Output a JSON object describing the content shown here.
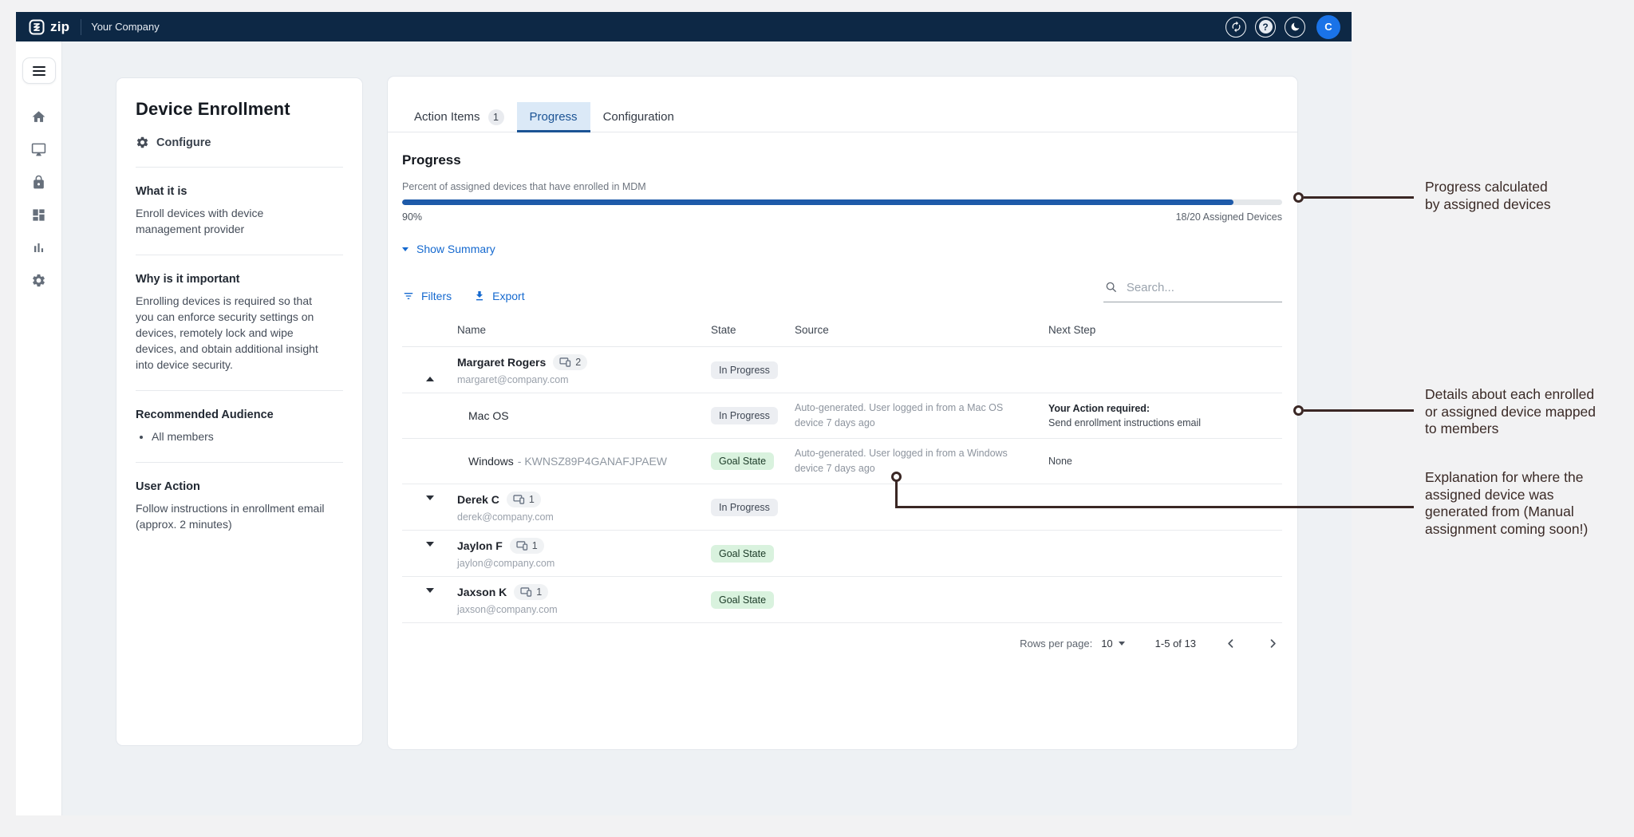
{
  "navbar": {
    "logo_text": "zip",
    "company_name": "Your Company",
    "avatar_initial": "C",
    "icons": [
      "sync-icon",
      "help-icon",
      "dark-mode-moon-icon"
    ],
    "colors": {
      "background": "#0d2845",
      "avatar": "#1a73e8"
    }
  },
  "sidebar": {
    "items": [
      {
        "icon": "home-icon"
      },
      {
        "icon": "monitor-icon"
      },
      {
        "icon": "lock-icon"
      },
      {
        "icon": "dashboard-icon"
      },
      {
        "icon": "bar-chart-icon"
      },
      {
        "icon": "gear-icon"
      }
    ]
  },
  "info_panel": {
    "title": "Device Enrollment",
    "configure_label": "Configure",
    "what_heading": "What it is",
    "what_body": "Enroll devices with device management provider",
    "why_heading": "Why is it important",
    "why_body": "Enrolling devices is required so that you can enforce security settings on devices, remotely lock and wipe devices, and obtain additional insight into device security.",
    "audience_heading": "Recommended Audience",
    "audience_items": [
      "All members"
    ],
    "action_heading": "User Action",
    "action_body": "Follow instructions in enrollment email (approx. 2 minutes)"
  },
  "main": {
    "tabs": [
      {
        "label": "Action Items",
        "badge": "1"
      },
      {
        "label": "Progress",
        "active": true
      },
      {
        "label": "Configuration"
      }
    ],
    "progress": {
      "heading": "Progress",
      "subtitle": "Percent of assigned devices that have enrolled in MDM",
      "percent_label": "90%",
      "fill_pct": 94.5,
      "assigned_label": "18/20 Assigned Devices",
      "fill_color": "#1e5aa9"
    },
    "summary_toggle_label": "Show Summary",
    "toolbar": {
      "filters_label": "Filters",
      "export_label": "Export",
      "search_placeholder": "Search..."
    },
    "table": {
      "columns": [
        "Name",
        "State",
        "Source",
        "Next Step"
      ],
      "rows": [
        {
          "kind": "member",
          "expanded": true,
          "name": "Margaret Rogers",
          "device_count": "2",
          "email": "margaret@company.com",
          "state": "In Progress",
          "state_kind": "in-progress"
        },
        {
          "kind": "device",
          "name": "Mac OS",
          "state": "In Progress",
          "state_kind": "in-progress",
          "source": "Auto-generated. User logged in from a Mac OS device 7 days ago",
          "next_step_title": "Your Action required:",
          "next_step": "Send enrollment instructions email"
        },
        {
          "kind": "device",
          "name": "Windows",
          "serial": "- KWNSZ89P4GANAFJPAEW",
          "state": "Goal State",
          "state_kind": "goal",
          "source": "Auto-generated. User logged in from a Windows device 7 days ago",
          "next_step": "None"
        },
        {
          "kind": "member",
          "expanded": false,
          "name": "Derek C",
          "device_count": "1",
          "email": "derek@company.com",
          "state": "In Progress",
          "state_kind": "in-progress"
        },
        {
          "kind": "member",
          "expanded": false,
          "name": "Jaylon F",
          "device_count": "1",
          "email": "jaylon@company.com",
          "state": "Goal State",
          "state_kind": "goal"
        },
        {
          "kind": "member",
          "expanded": false,
          "name": "Jaxson K",
          "device_count": "1",
          "email": "jaxson@company.com",
          "state": "Goal State",
          "state_kind": "goal"
        }
      ]
    },
    "pagination": {
      "rows_per_page_label": "Rows per page:",
      "rows_per_page_value": "10",
      "range_label": "1-5 of 13"
    }
  },
  "annotations": [
    {
      "lines": [
        "Progress calculated",
        "by assigned devices"
      ]
    },
    {
      "lines": [
        "Details about each enrolled",
        "or assigned device mapped",
        "to members"
      ]
    },
    {
      "lines": [
        "Explanation for where the",
        "assigned device was",
        "generated from (Manual",
        "assignment coming soon!)"
      ]
    }
  ],
  "annotation_color": "#3a2724"
}
